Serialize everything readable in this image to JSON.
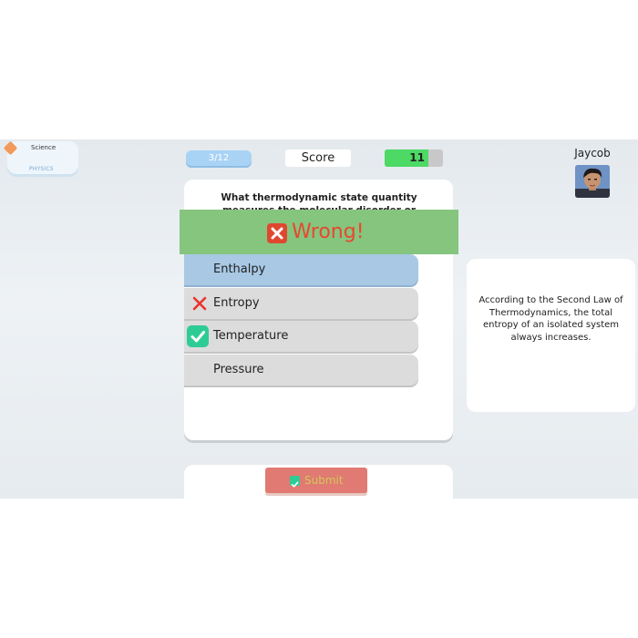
{
  "topic": {
    "title": "Science",
    "subject": "PHYSICS"
  },
  "header": {
    "progress": "3/12",
    "score_label": "Score",
    "score_value": "11"
  },
  "player": {
    "name": "Jaycob",
    "avatar": "player-avatar"
  },
  "question": {
    "text": "What thermodynamic state quantity measures the molecular disorder or randomness of a system?",
    "answers": [
      {
        "label": "Enthalpy",
        "state": "selected"
      },
      {
        "label": "Entropy",
        "state": "correct-answer-missed",
        "icon": "x-icon"
      },
      {
        "label": "Temperature",
        "state": "checked",
        "icon": "check-icon"
      },
      {
        "label": "Pressure",
        "state": "default"
      }
    ]
  },
  "feedback": {
    "text": "Wrong!",
    "icon": "x-icon"
  },
  "explanation": {
    "text": "According to the Second Law of Thermodynamics, the total entropy of an isolated system always increases."
  },
  "submit": {
    "label": "Submit",
    "icon": "check-icon"
  },
  "colors": {
    "progress": "#a9d3f5",
    "score_fill": "#4cd964",
    "banner": "#85c57e",
    "wrong": "#e8472f",
    "selected": "#a8c8e4",
    "submit": "#e07a72",
    "check": "#2ecc95"
  }
}
